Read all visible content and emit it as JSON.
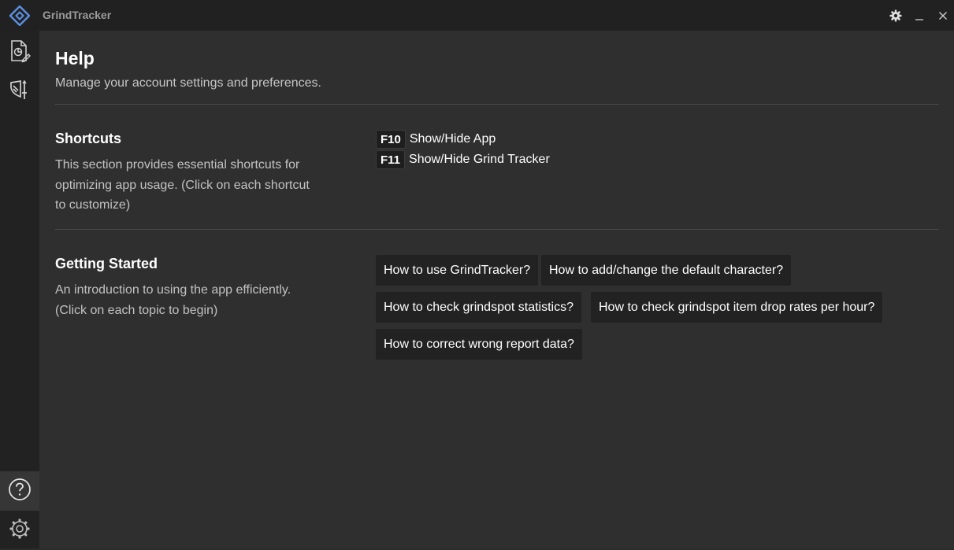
{
  "app": {
    "title": "GrindTracker"
  },
  "titlebar": {
    "icons": [
      "gear-icon",
      "minimize-icon",
      "close-icon"
    ]
  },
  "sidebar": {
    "top_items": [
      {
        "name": "report-icon"
      },
      {
        "name": "shield-sword-icon"
      }
    ],
    "bottom_items": [
      {
        "name": "help-icon",
        "active": true
      },
      {
        "name": "settings-icon"
      }
    ]
  },
  "page": {
    "title": "Help",
    "subtitle": "Manage your account settings and preferences."
  },
  "shortcuts": {
    "title": "Shortcuts",
    "description": "This section provides essential shortcuts for optimizing app usage. (Click on each shortcut to customize)",
    "items": [
      {
        "key": "F10",
        "label": "Show/Hide App"
      },
      {
        "key": "F11",
        "label": "Show/Hide Grind Tracker"
      }
    ]
  },
  "getting_started": {
    "title": "Getting Started",
    "description": "An introduction to using the app efficiently. (Click on each topic to begin)",
    "topics": [
      "How to use GrindTracker?",
      "How to add/change the default character?",
      "How to check grindspot statistics?",
      "How to check grindspot item drop rates per hour?",
      "How to correct wrong report data?"
    ]
  },
  "colors": {
    "background": "#2f2f2f",
    "sidebar": "#222222",
    "accent": "#5b8fe0"
  }
}
